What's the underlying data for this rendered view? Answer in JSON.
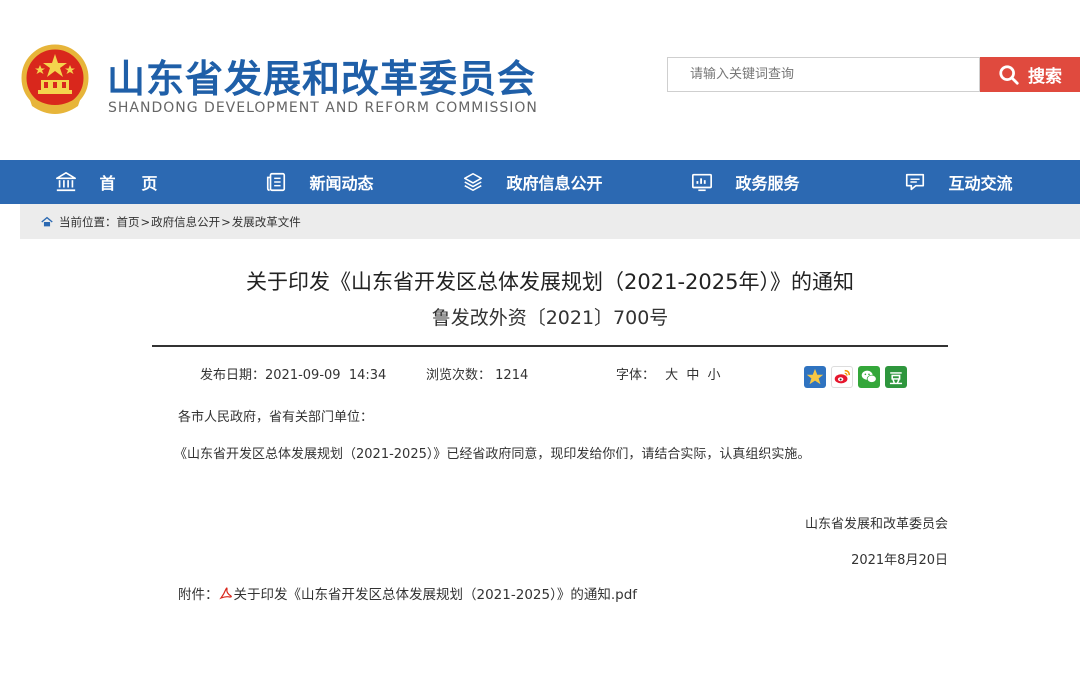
{
  "header": {
    "title": "山东省发展和改革委员会",
    "subtitle": "SHANDONG DEVELOPMENT AND REFORM COMMISSION",
    "emblem_icon": "national-emblem-icon"
  },
  "search": {
    "placeholder": "请输入关键词查询",
    "button_label": "搜索",
    "button_color": "#e04a3e"
  },
  "nav": {
    "color": "#2c69b2",
    "items": [
      {
        "label": "首页",
        "icon": "bank-icon"
      },
      {
        "label": "新闻动态",
        "icon": "news-icon"
      },
      {
        "label": "政府信息公开",
        "icon": "layers-icon"
      },
      {
        "label": "政务服务",
        "icon": "chart-icon"
      },
      {
        "label": "互动交流",
        "icon": "chat-icon"
      }
    ]
  },
  "breadcrumb": {
    "prefix": "当前位置：",
    "items": [
      "首页",
      "政府信息公开",
      "发展改革文件"
    ],
    "separator": ">"
  },
  "article": {
    "title": "关于印发《山东省开发区总体发展规划（2021-2025年）》的通知",
    "doc_number": "鲁发改外资〔2021〕700号",
    "date_label": "发布日期：",
    "date_value": "2021-09-09  14:34",
    "views_label": "浏览次数：",
    "views_value": "1214",
    "font_label": "字体：",
    "font_sizes": [
      "大",
      "中",
      "小"
    ],
    "greeting": "各市人民政府，省有关部门单位：",
    "paragraph": "《山东省开发区总体发展规划（2021-2025）》已经省政府同意，现印发给你们，请结合实际，认真组织实施。",
    "signature": "山东省发展和改革委员会",
    "sign_date": "2021年8月20日",
    "attachment_label": "附件：",
    "attachment_name": "关于印发《山东省开发区总体发展规划（2021-2025）》的通知.pdf"
  },
  "share": {
    "items": [
      "qzone-icon",
      "weibo-icon",
      "wechat-icon",
      "douban-icon"
    ],
    "douban_label": "豆"
  }
}
